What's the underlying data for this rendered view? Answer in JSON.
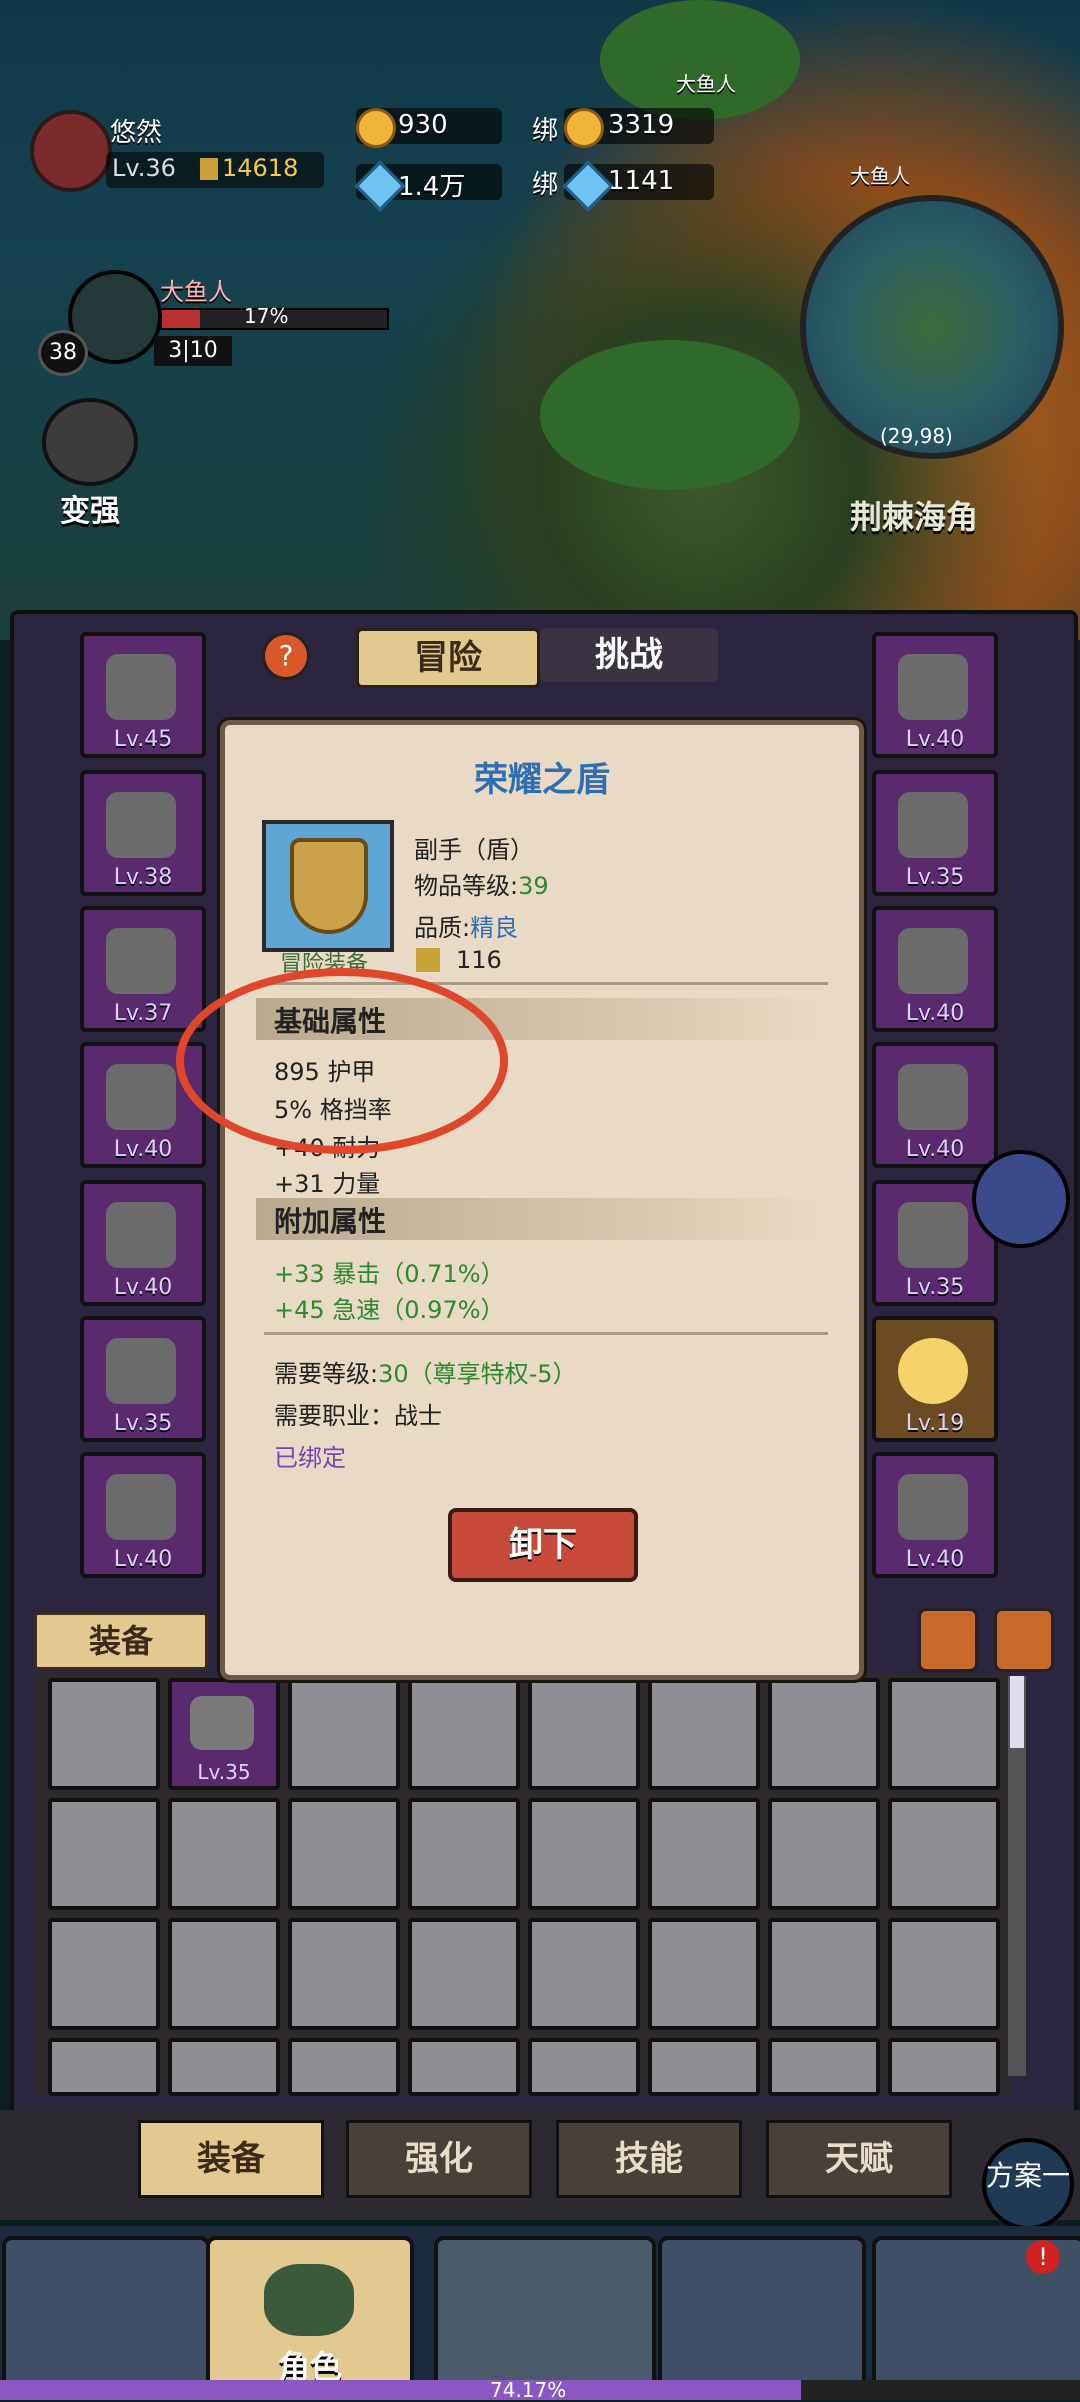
{
  "player": {
    "name": "悠然",
    "level": "Lv.36",
    "power": "14618"
  },
  "resources": {
    "coins": "930",
    "gems": "1.4万",
    "bind_label_1": "绑",
    "bound_coins": "3319",
    "bind_label_2": "绑",
    "bound_gems": "1141"
  },
  "boss": {
    "name": "大鱼人",
    "hp_percent": "17%",
    "hp_fraction": 0.17,
    "level": "38",
    "count": "3|10"
  },
  "strengthen_label": "变强",
  "map": {
    "coords": "(29,98)",
    "location": "荆棘海角",
    "marker_1": "大鱼人",
    "marker_2": "大鱼人"
  },
  "panel_tabs": [
    "冒险",
    "挑战"
  ],
  "left_slots": [
    "Lv.45",
    "Lv.38",
    "Lv.37",
    "Lv.40",
    "Lv.40",
    "Lv.35",
    "Lv.40"
  ],
  "right_slots": [
    "Lv.40",
    "Lv.35",
    "Lv.40",
    "Lv.40",
    "Lv.35",
    "Lv.19",
    "Lv.40"
  ],
  "inventory": {
    "tab_label": "装备",
    "first_item_level": "Lv.35"
  },
  "tooltip": {
    "title": "荣耀之盾",
    "slot": "副手（盾）",
    "item_level_label": "物品等级:",
    "item_level": "39",
    "quality_label": "品质:",
    "quality": "精良",
    "score": "116",
    "tag": "冒险装备",
    "base_header": "基础属性",
    "base_stats": [
      "895 护甲",
      "5% 格挡率",
      "+40 耐力",
      "+31 力量"
    ],
    "extra_header": "附加属性",
    "extra_stats": [
      "+33 暴击（0.71%）",
      "+45 急速（0.97%）"
    ],
    "req_level_label": "需要等级:",
    "req_level": "30（尊享特权-5）",
    "req_class": "需要职业：战士",
    "bound": "已绑定",
    "unequip_label": "卸下"
  },
  "bottom_tabs": [
    "装备",
    "强化",
    "技能",
    "天赋"
  ],
  "plan_label": "方案一",
  "nav": {
    "role_label": "角色"
  },
  "xp": {
    "percent": "74.17%",
    "fraction": 0.7417
  },
  "colors": {
    "accent_gold": "#e2c990",
    "panel_purple": "#5a2a6e",
    "highlight_circle": "#e0472a",
    "green_stat": "#2c8a2c",
    "title_blue": "#2d6fb2"
  }
}
